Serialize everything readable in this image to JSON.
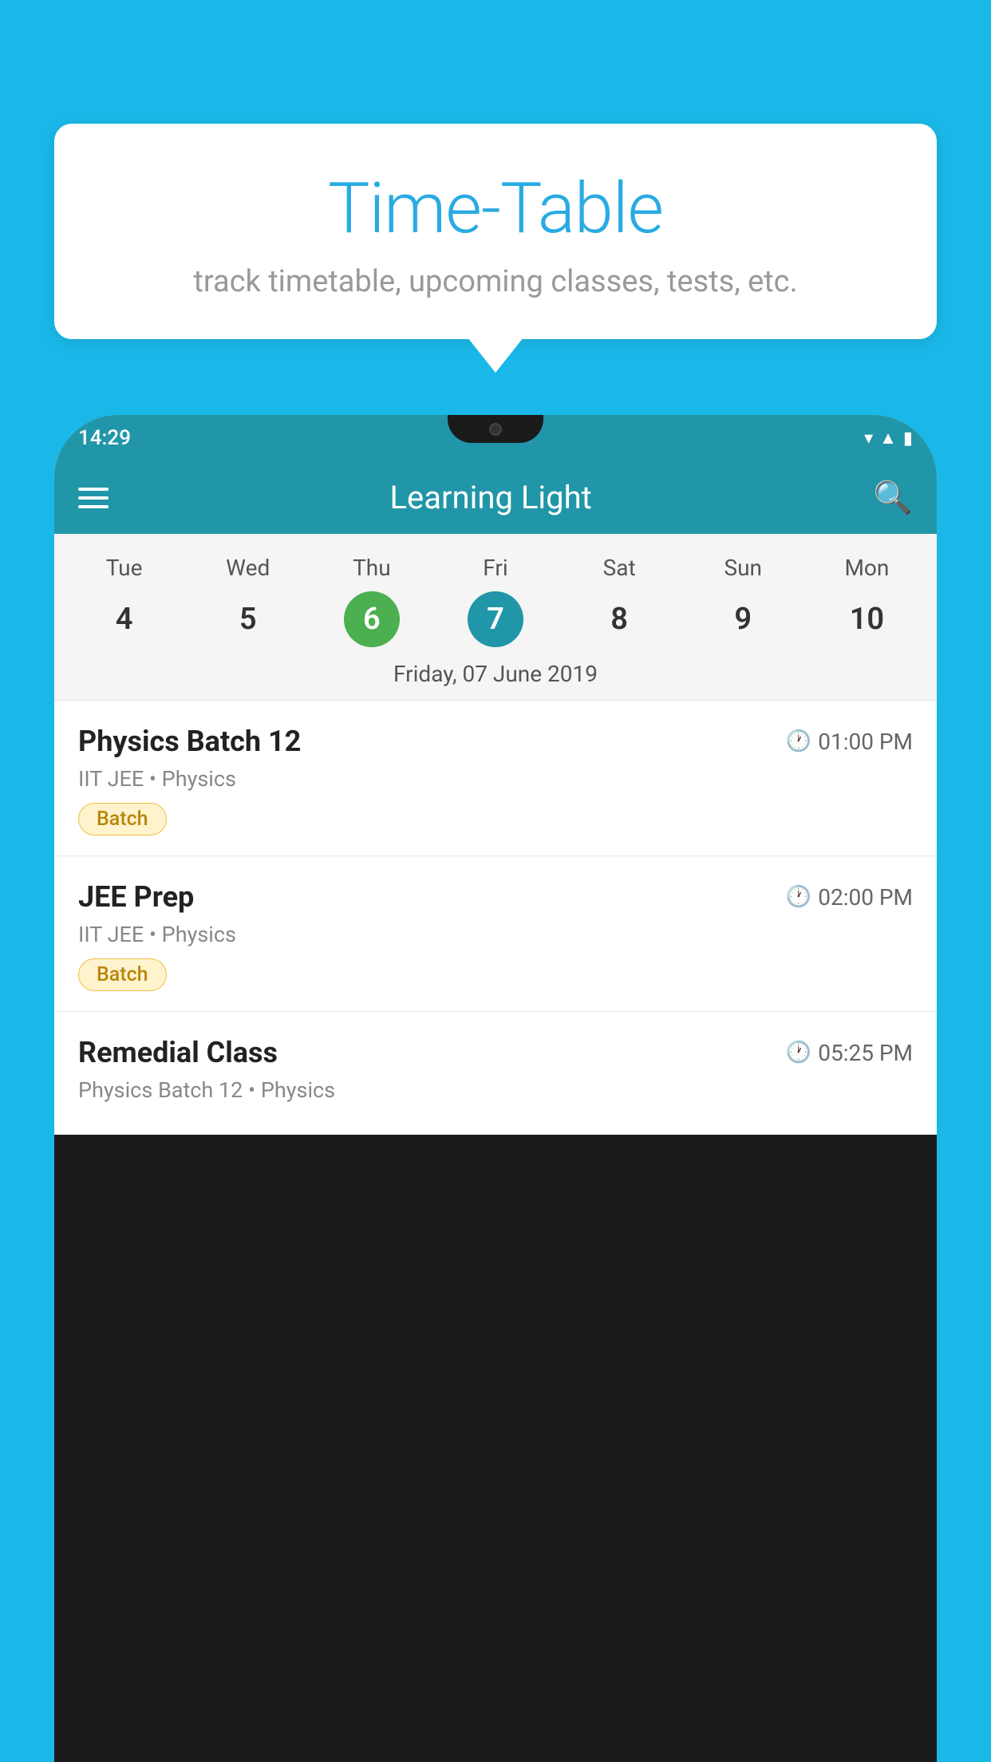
{
  "background_color": "#1ab8e8",
  "bubble": {
    "title": "Time-Table",
    "subtitle": "track timetable, upcoming classes, tests, etc."
  },
  "phone": {
    "status_bar": {
      "time": "14:29"
    },
    "app_header": {
      "title": "Learning Light"
    },
    "calendar": {
      "days": [
        "Tue",
        "Wed",
        "Thu",
        "Fri",
        "Sat",
        "Sun",
        "Mon"
      ],
      "dates": [
        4,
        5,
        6,
        7,
        8,
        9,
        10
      ],
      "today_index": 2,
      "selected_index": 3,
      "selected_date_label": "Friday, 07 June 2019"
    },
    "classes": [
      {
        "name": "Physics Batch 12",
        "time": "01:00 PM",
        "subtitle": "IIT JEE • Physics",
        "badge": "Batch"
      },
      {
        "name": "JEE Prep",
        "time": "02:00 PM",
        "subtitle": "IIT JEE • Physics",
        "badge": "Batch"
      },
      {
        "name": "Remedial Class",
        "time": "05:25 PM",
        "subtitle": "Physics Batch 12 • Physics",
        "badge": null
      }
    ]
  }
}
